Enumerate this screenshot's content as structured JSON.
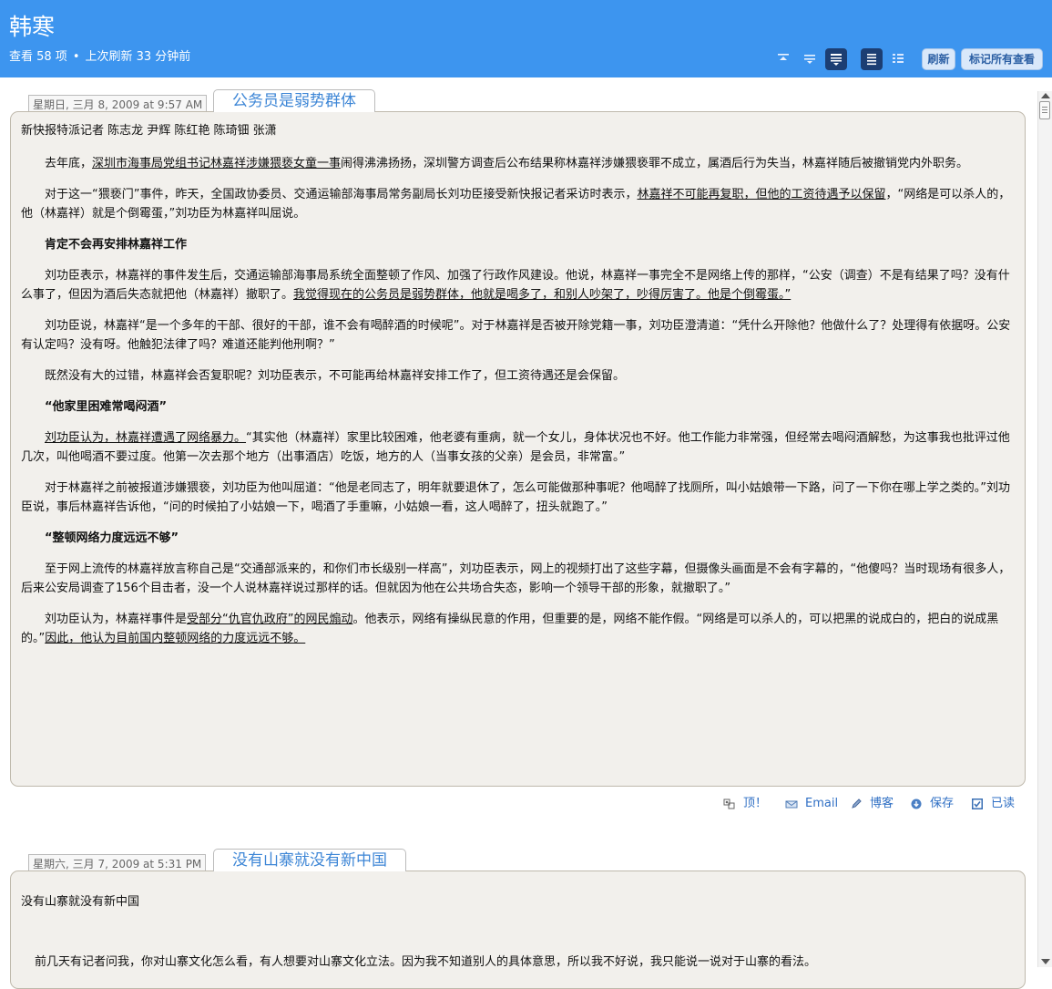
{
  "header": {
    "title": "韩寒",
    "count_text": "查看 58 项",
    "dot": "•",
    "refresh_time": "上次刷新 33 分钟前",
    "refresh_button": "刷新",
    "mark_all_read_button": "标记所有查看"
  },
  "entry1": {
    "date": "星期日, 三月 8, 2009 at 9:57 AM",
    "title": "公务员是弱势群体",
    "reporters": "新快报特派记者 陈志龙 尹辉 陈红艳 陈琦钿 张潇",
    "p1_a": "去年底，",
    "p1_link": "深圳市海事局党组书记林嘉祥涉嫌猥亵女童一事",
    "p1_b": "闹得沸沸扬扬，深圳警方调查后公布结果称林嘉祥涉嫌猥亵罪不成立，属酒后行为失当，林嘉祥随后被撤销党内外职务。",
    "p2_a": "对于这一“猥亵门”事件，昨天，全国政协委员、交通运输部海事局常务副局长刘功臣接受新快报记者采访时表示，",
    "p2_u": "林嘉祥不可能再复职，但他的工资待遇予以保留",
    "p2_b": "，“网络是可以杀人的，他（林嘉祥）就是个倒霉蛋，”刘功臣为林嘉祥叫屈说。",
    "h1": "肯定不会再安排林嘉祥工作",
    "p3_a": "刘功臣表示，林嘉祥的事件发生后，交通运输部海事局系统全面整顿了作风、加强了行政作风建设。他说，林嘉祥一事完全不是网络上传的那样，“公安（调查）不是有结果了吗？没有什么事了，但因为酒后失态就把他（林嘉祥）撤职了。",
    "p3_u": "我觉得现在的公务员是弱势群体，他就是喝多了，和别人吵架了，吵得厉害了。他是个倒霉蛋。”",
    "p4": "刘功臣说，林嘉祥“是一个多年的干部、很好的干部，谁不会有喝醉酒的时候呢”。对于林嘉祥是否被开除党籍一事，刘功臣澄清道：“凭什么开除他？他做什么了？处理得有依据呀。公安有认定吗？没有呀。他触犯法律了吗？难道还能判他刑啊？”",
    "p5": "既然没有大的过错，林嘉祥会否复职呢？刘功臣表示，不可能再给林嘉祥安排工作了，但工资待遇还是会保留。",
    "h2": "“他家里困难常喝闷酒”",
    "p6_u": "刘功臣认为，林嘉祥遭遇了网络暴力。",
    "p6_b": "“其实他（林嘉祥）家里比较困难，他老婆有重病，就一个女儿，身体状况也不好。他工作能力非常强，但经常去喝闷酒解愁，为这事我也批评过他几次，叫他喝酒不要过度。他第一次去那个地方（出事酒店）吃饭，地方的人（当事女孩的父亲）是会员，非常富。”",
    "p7": "对于林嘉祥之前被报道涉嫌猥亵，刘功臣为他叫屈道：“他是老同志了，明年就要退休了，怎么可能做那种事呢？他喝醉了找厕所，叫小姑娘带一下路，问了一下你在哪上学之类的。”刘功臣说，事后林嘉祥告诉他，“问的时候拍了小姑娘一下，喝酒了手重嘛，小姑娘一看，这人喝醉了，扭头就跑了。”",
    "h3": "“整顿网络力度远远不够”",
    "p8": "至于网上流传的林嘉祥放言称自己是“交通部派来的，和你们市长级别一样高”，刘功臣表示，网上的视频打出了这些字幕，但摄像头画面是不会有字幕的，“他傻吗？当时现场有很多人，后来公安局调查了156个目击者，没一个人说林嘉祥说过那样的话。但就因为他在公共场合失态，影响一个领导干部的形象，就撤职了。”",
    "p9_a": "刘功臣认为，林嘉祥事件是",
    "p9_u1": "受部分“仇官仇政府”的网民煽动",
    "p9_b": "。他表示，网络有操纵民意的作用，但重要的是，网络不能作假。“网络是可以杀人的，可以把黑的说成白的，把白的说成黑的。”",
    "p9_u2": "因此，他认为目前国内整顿网络的力度远远不够。"
  },
  "actions": {
    "digg": "顶！",
    "email": "Email",
    "blog": "博客",
    "save": "保存",
    "read": "已读"
  },
  "entry2": {
    "date": "星期六, 三月 7, 2009 at 5:31 PM",
    "title": "没有山寨就没有新中国",
    "meta": "没有山寨就没有新中国",
    "first_line": "前几天有记者问我，你对山寨文化怎么看，有人想要对山寨文化立法。因为我不知道别人的具体意思，所以我不好说，我只能说一说对于山寨的看法。"
  },
  "colors": {
    "header_bg": "#3d95ef",
    "active_view_button": "#1c3e73",
    "card_bg": "#f2f0ec",
    "link": "#2f6fc4",
    "title_tab_text": "#3d86d6"
  }
}
